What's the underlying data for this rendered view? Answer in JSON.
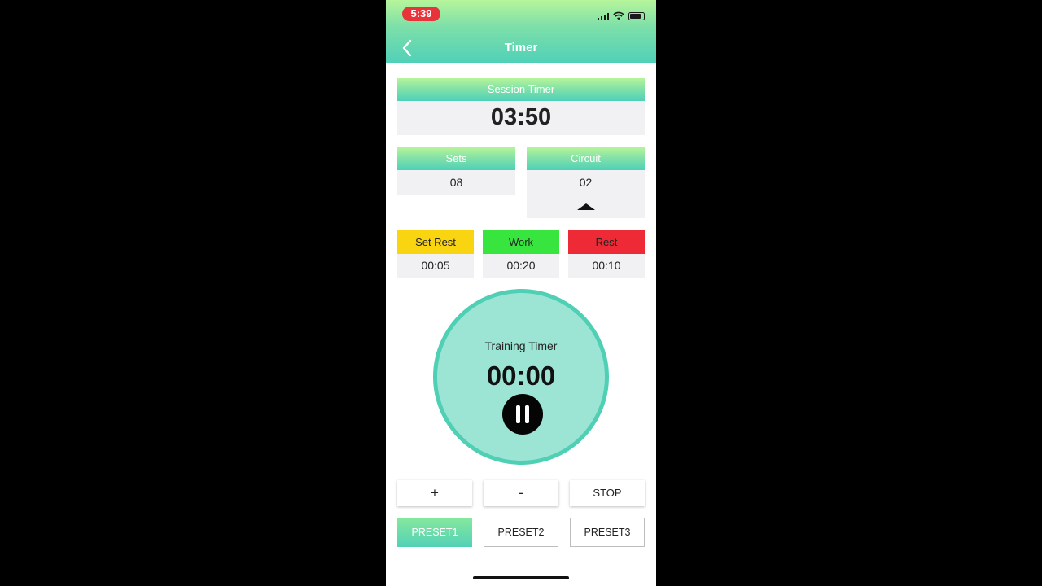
{
  "status_bar": {
    "time": "5:39",
    "icons": [
      "cellular-signal-icon",
      "wifi-icon",
      "battery-icon"
    ]
  },
  "header": {
    "title": "Timer",
    "back_icon": "chevron-left-icon"
  },
  "session_timer": {
    "label": "Session Timer",
    "value": "03:50"
  },
  "sets": {
    "label": "Sets",
    "value": "08"
  },
  "circuit": {
    "label": "Circuit",
    "value": "02"
  },
  "intervals": [
    {
      "label": "Set Rest",
      "value": "00:05",
      "color": "#f9d411"
    },
    {
      "label": "Work",
      "value": "00:20",
      "color": "#38e43e"
    },
    {
      "label": "Rest",
      "value": "00:10",
      "color": "#ee2a36"
    }
  ],
  "training_timer": {
    "label": "Training Timer",
    "value": "00:00",
    "button_icon": "pause-icon"
  },
  "controls": {
    "plus": "+",
    "minus": "-",
    "stop": "STOP"
  },
  "presets": [
    {
      "label": "PRESET1",
      "selected": true
    },
    {
      "label": "PRESET2",
      "selected": false
    },
    {
      "label": "PRESET3",
      "selected": false
    }
  ],
  "colors": {
    "accent_gradient_top": "#b6f59a",
    "accent_gradient_bottom": "#4fd0b8",
    "circle_fill": "#9ce5d5",
    "circle_border": "#4fcfb3"
  }
}
